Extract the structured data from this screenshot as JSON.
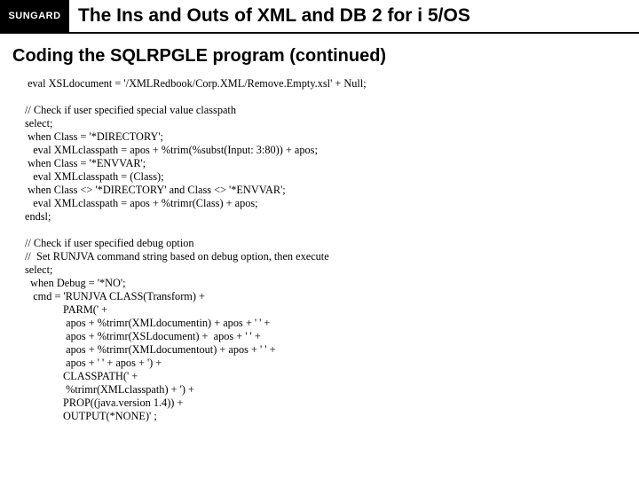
{
  "header": {
    "logo": "SUNGARD",
    "title": "The Ins and Outs of XML and DB 2 for i 5/OS"
  },
  "subhead": "Coding the SQLRPGLE program (continued)",
  "code": " eval XSLdocument = '/XMLRedbook/Corp.XML/Remove.Empty.xsl' + Null;\n\n// Check if user specified special value classpath\nselect;\n when Class = '*DIRECTORY';\n   eval XMLclasspath = apos + %trim(%subst(Input: 3:80)) + apos;\n when Class = '*ENVVAR';\n   eval XMLclasspath = (Class);\n when Class <> '*DIRECTORY' and Class <> '*ENVVAR';\n   eval XMLclasspath = apos + %trimr(Class) + apos;\nendsl;\n\n// Check if user specified debug option\n//  Set RUNJVA command string based on debug option, then execute\nselect;\n  when Debug = '*NO';\n   cmd = 'RUNJVA CLASS(Transform) +\n              PARM(' +\n               apos + %trimr(XMLdocumentin) + apos + ' ' +\n               apos + %trimr(XSLdocument) +  apos + ' ' +\n               apos + %trimr(XMLdocumentout) + apos + ' ' +\n               apos + ' ' + apos + ') +\n              CLASSPATH(' +\n               %trimr(XMLclasspath) + ') +\n              PROP((java.version 1.4)) +\n              OUTPUT(*NONE)' ;"
}
